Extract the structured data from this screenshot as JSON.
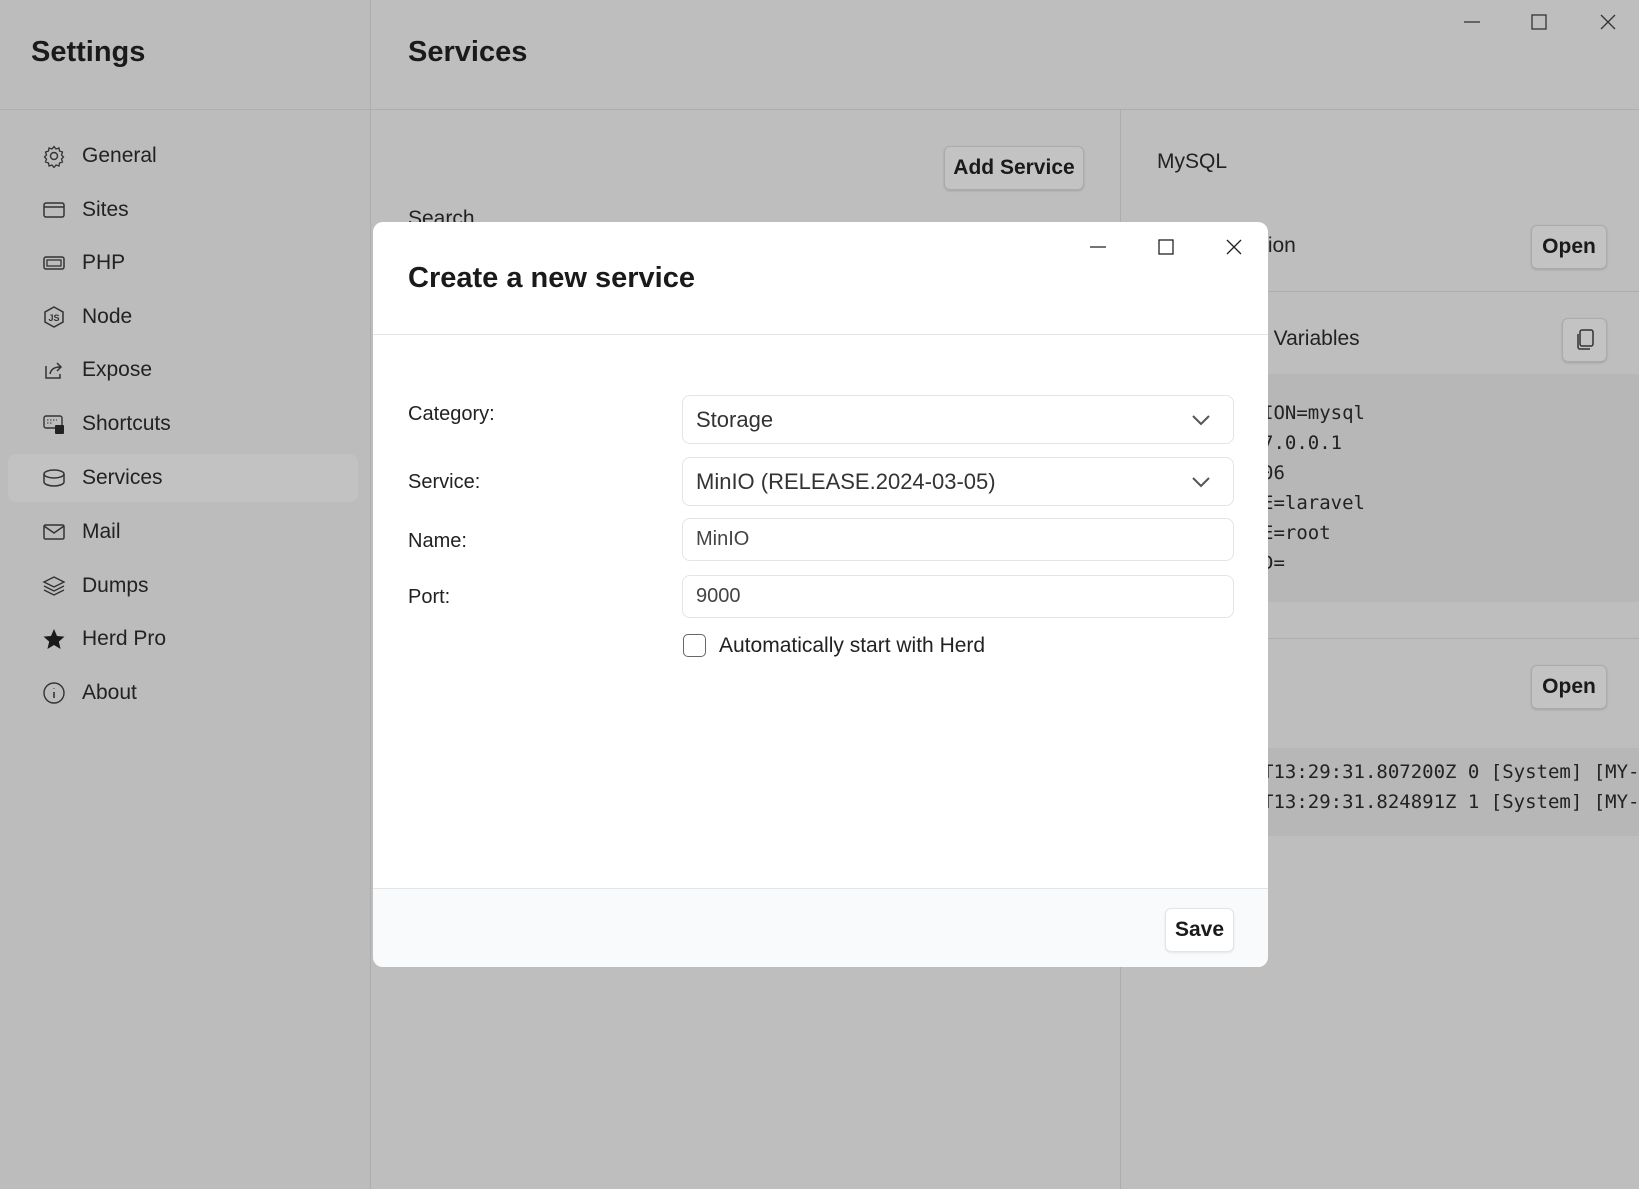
{
  "window": {
    "controls": [
      "minimize",
      "maximize",
      "close"
    ]
  },
  "sidebar": {
    "title": "Settings",
    "items": [
      {
        "label": "General",
        "icon": "gear-icon"
      },
      {
        "label": "Sites",
        "icon": "window-icon"
      },
      {
        "label": "PHP",
        "icon": "chip-icon"
      },
      {
        "label": "Node",
        "icon": "nodejs-icon"
      },
      {
        "label": "Expose",
        "icon": "share-icon"
      },
      {
        "label": "Shortcuts",
        "icon": "keyboard-shortcut-icon"
      },
      {
        "label": "Services",
        "icon": "database-icon",
        "selected": true
      },
      {
        "label": "Mail",
        "icon": "mail-icon"
      },
      {
        "label": "Dumps",
        "icon": "layers-icon"
      },
      {
        "label": "Herd Pro",
        "icon": "star-icon"
      },
      {
        "label": "About",
        "icon": "info-icon"
      }
    ]
  },
  "main": {
    "title": "Services",
    "add_service_label": "Add Service",
    "search_label": "Search"
  },
  "detail": {
    "service_name": "MySQL",
    "row1_label_partial": "tion",
    "open_label": "Open",
    "env_label_partial": "t Variables",
    "env_lines": [
      "ION=mysql",
      "7.0.0.1",
      "06",
      "E=laravel",
      "E=root",
      "D="
    ],
    "open_label_2": "Open",
    "log_lines": [
      "T13:29:31.807200Z 0 [System] [MY-",
      "T13:29:31.824891Z 1 [System] [MY-"
    ]
  },
  "modal": {
    "title": "Create a new service",
    "category_label": "Category:",
    "category_value": "Storage",
    "service_label": "Service:",
    "service_value": "MinIO (RELEASE.2024-03-05)",
    "name_label": "Name:",
    "name_value": "MinIO",
    "port_label": "Port:",
    "port_value": "9000",
    "autostart_label": "Automatically start with Herd",
    "autostart_checked": false,
    "save_label": "Save"
  }
}
